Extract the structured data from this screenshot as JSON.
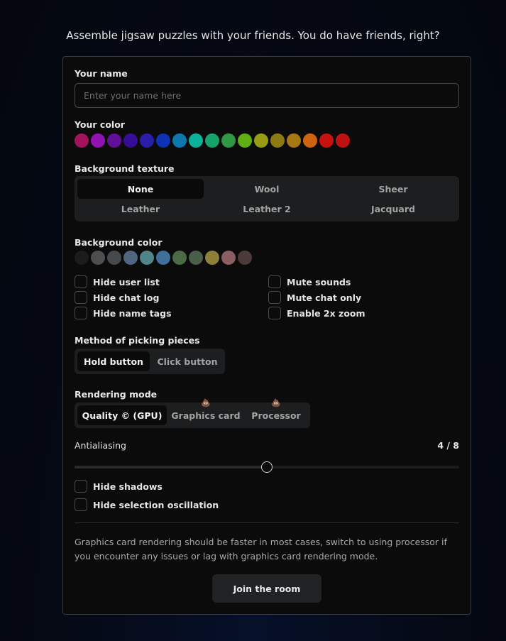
{
  "tagline": "Assemble jigsaw puzzles with your friends. You do have friends, right?",
  "name": {
    "label": "Your name",
    "placeholder": "Enter your name here"
  },
  "color": {
    "label": "Your color",
    "swatches": [
      "#a3135c",
      "#9012b3",
      "#5f1096",
      "#360d96",
      "#2a1ea8",
      "#0d32b3",
      "#0d78b0",
      "#0bb29a",
      "#14a36b",
      "#2e9845",
      "#5fae12",
      "#989b14",
      "#8d7a12",
      "#a67713",
      "#d0640e",
      "#c5120f",
      "#be1212"
    ]
  },
  "texture": {
    "label": "Background texture",
    "options": [
      "None",
      "Wool",
      "Sheer",
      "Leather",
      "Leather 2",
      "Jacquard"
    ],
    "selected": "None"
  },
  "bgcolor": {
    "label": "Background color",
    "swatches": [
      "#1c1c1c",
      "#4e4e50",
      "#464a4d",
      "#4f6580",
      "#4f8489",
      "#3f6f9a",
      "#4b6b47",
      "#4a5e4a",
      "#8c7f3a",
      "#8a5e62",
      "#4d3a3a"
    ]
  },
  "toggles": {
    "hide_user_list": "Hide user list",
    "hide_chat_log": "Hide chat log",
    "hide_name_tags": "Hide name tags",
    "mute_sounds": "Mute sounds",
    "mute_chat_only": "Mute chat only",
    "enable_zoom": "Enable 2x zoom"
  },
  "picking": {
    "label": "Method of picking pieces",
    "hold": "Hold button",
    "click": "Click button",
    "selected": "Hold button"
  },
  "rendering": {
    "label": "Rendering mode",
    "quality": "Quality © (GPU)",
    "gpu": "Graphics card",
    "cpu": "Processor",
    "warn_icon": "💩",
    "selected": "Quality © (GPU)"
  },
  "antialiasing": {
    "label": "Antialiasing",
    "value_text": "4 / 8",
    "value": 4,
    "max": 8
  },
  "extra": {
    "hide_shadows": "Hide shadows",
    "hide_selection_osc": "Hide selection oscillation"
  },
  "note": "Graphics card rendering should be faster in most cases, switch to using processor if you encounter any issues or lag with graphics card rendering mode.",
  "join": "Join the room"
}
